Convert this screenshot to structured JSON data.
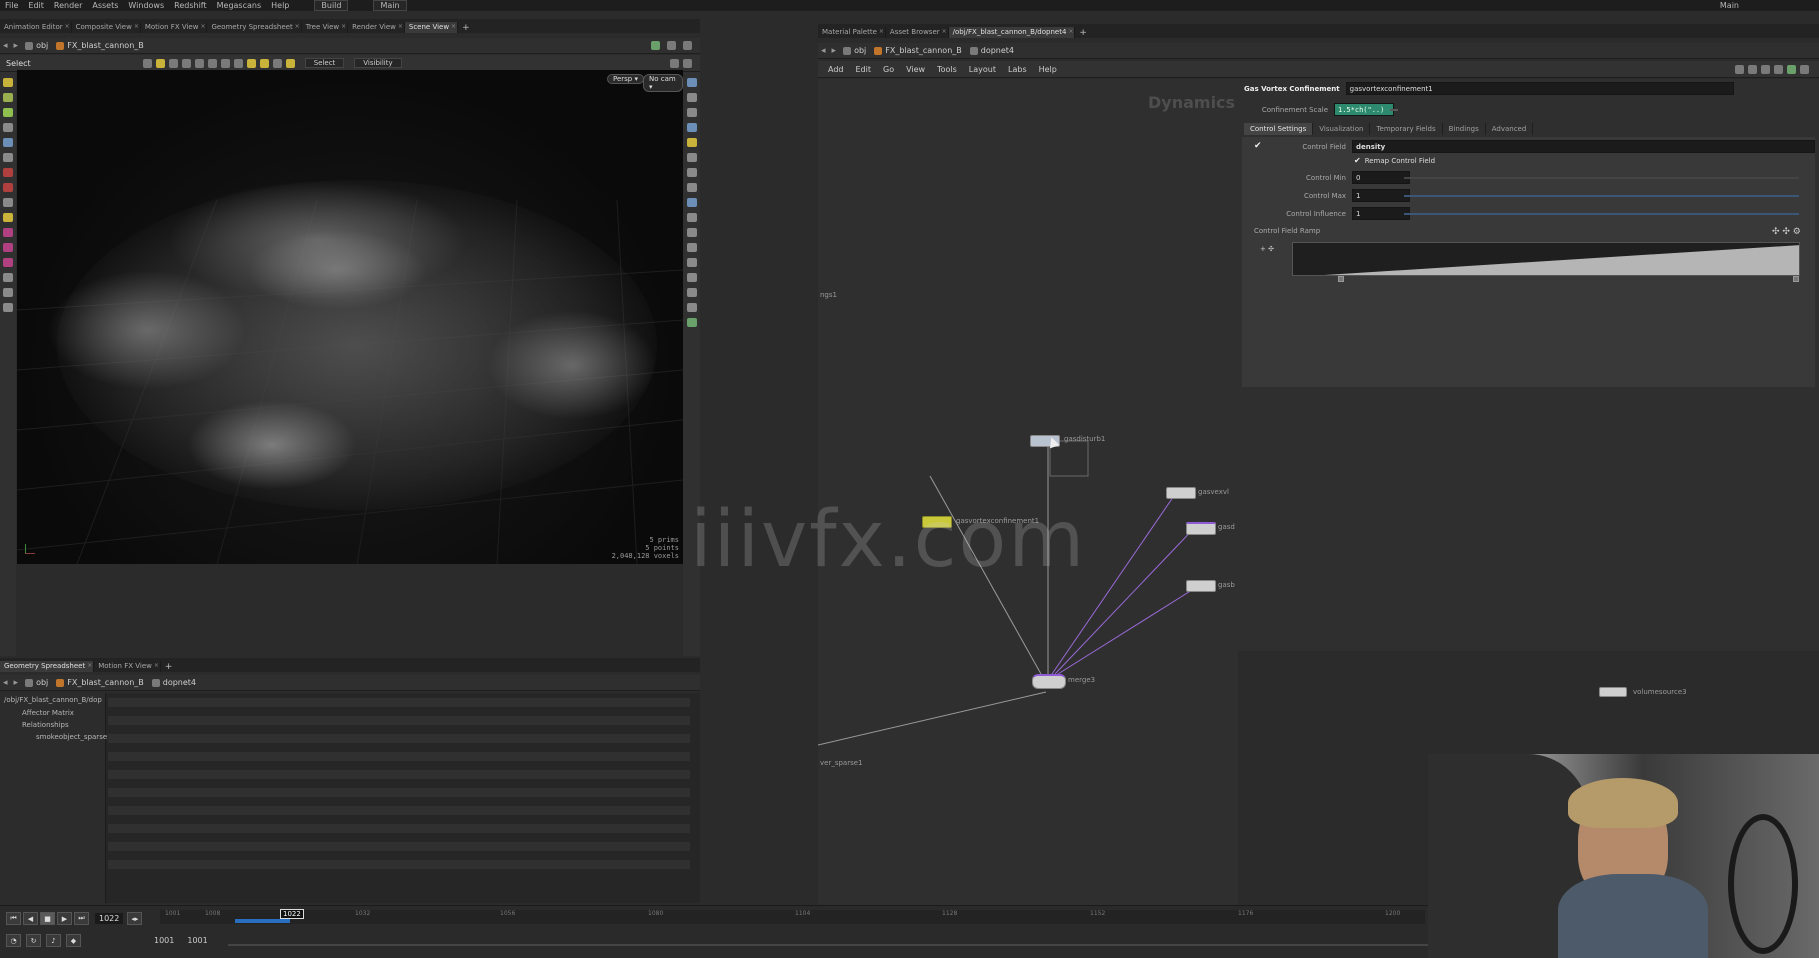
{
  "menubar": {
    "items": [
      "File",
      "Edit",
      "Render",
      "Assets",
      "Windows",
      "Redshift",
      "Megascans",
      "Help"
    ],
    "desktop": "Build",
    "context": "Main",
    "right_label": "Main"
  },
  "left_tabs": [
    "Animation Editor",
    "Composite View",
    "Motion FX View",
    "Geometry Spreadsheet",
    "Tree View",
    "Render View",
    "Scene View"
  ],
  "left_path": {
    "root": "obj",
    "node": "FX_blast_cannon_B"
  },
  "viewport_toolbar": {
    "select_label": "Select",
    "select_dropdown": "Select",
    "visibility_dropdown": "Visibility"
  },
  "viewport": {
    "persp": "Persp ▾",
    "cam": "No cam ▾",
    "stats": [
      "5  prims",
      "5 points",
      "2,048,128 voxels"
    ],
    "axis_label": "",
    "watermark": "iiivfx.com"
  },
  "bottom_left": {
    "tabs": [
      "Geometry Spreadsheet",
      "Motion FX View"
    ],
    "path": {
      "root": "obj",
      "node": "FX_blast_cannon_B",
      "net": "dopnet4"
    },
    "tree": [
      "/obj/FX_blast_cannon_B/dop",
      "Affector Matrix",
      "Relationships",
      "smokeobject_sparse1"
    ]
  },
  "timeline": {
    "current_frame": "1022",
    "playhead": "1022",
    "ticks": [
      "1001",
      "1008",
      "1032",
      "1056",
      "1080",
      "1104",
      "1128",
      "1152",
      "1176",
      "1200"
    ],
    "start": "1001",
    "end": "1001"
  },
  "right_tabs": [
    "Material Palette",
    "Asset Browser",
    "/obj/FX_blast_cannon_B/dopnet4"
  ],
  "right_path": {
    "root": "obj",
    "node": "FX_blast_cannon_B",
    "net": "dopnet4"
  },
  "net_menu": [
    "Add",
    "Edit",
    "Go",
    "View",
    "Tools",
    "Layout",
    "Labs",
    "Help"
  ],
  "network": {
    "context_label": "Dynamics",
    "edge_label_left": "ngs1",
    "bottom_label": "ver_sparse1",
    "nodes": {
      "gasdisturb": "gasdisturb1",
      "gasvortex": "gasvortexconfinement1",
      "gasvex": "gasvexvl",
      "gasd": "gasd",
      "gasb": "gasb",
      "merge": "merge3",
      "volumesource": "volumesource3"
    }
  },
  "parms": {
    "node_type": "Gas Vortex Confinement",
    "node_name": "gasvortexconfinement1",
    "confinement_scale_label": "Confinement Scale",
    "confinement_scale_value": "1.5*ch(\"..)",
    "tabs": [
      "Control Settings",
      "Visualization",
      "Temporary Fields",
      "Bindings",
      "Advanced"
    ],
    "control_field_label": "Control Field",
    "control_field_value": "density",
    "remap_label": "Remap Control Field",
    "control_min_label": "Control Min",
    "control_min_value": "0",
    "control_max_label": "Control Max",
    "control_max_value": "1",
    "control_influence_label": "Control Influence",
    "control_influence_value": "1",
    "ramp_label": "Control Field Ramp"
  },
  "colors": {
    "accent_blue": "#2a6fbf",
    "node_yellow": "#c9c93a",
    "node_purple": "#8f5ad6",
    "link_purple": "#9a6ad8"
  }
}
